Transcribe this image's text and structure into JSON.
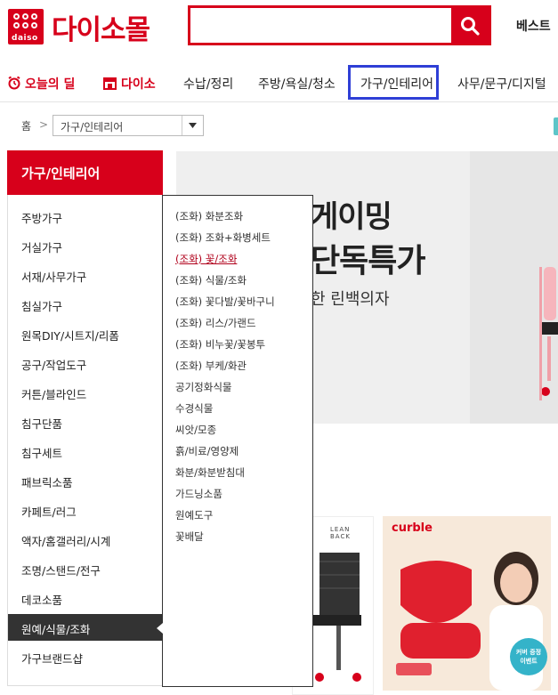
{
  "header": {
    "logo_word": "daiso",
    "logo_text": "다이소몰",
    "search_placeholder": "",
    "best_label": "베스트"
  },
  "nav": {
    "items": [
      {
        "label": "오늘의 딜",
        "icon": "alarm-clock-icon",
        "style": "red"
      },
      {
        "label": "다이소",
        "icon": "shop-icon",
        "style": "red"
      },
      {
        "label": "수납/정리"
      },
      {
        "label": "주방/욕실/청소"
      },
      {
        "label": "가구/인테리어",
        "active": true
      },
      {
        "label": "사무/문구/디지털"
      }
    ]
  },
  "breadcrumb": {
    "home": "홈",
    "select_value": "가구/인테리어"
  },
  "sidebar": {
    "title": "가구/인테리어",
    "items": [
      "주방가구",
      "거실가구",
      "서재/사무가구",
      "침실가구",
      "원목DIY/시트지/리폼",
      "공구/작업도구",
      "커튼/블라인드",
      "침구단품",
      "침구세트",
      "패브릭소품",
      "카페트/러그",
      "액자/홈갤러리/시계",
      "조명/스탠드/전구",
      "데코소품",
      "원예/식물/조화",
      "가구브랜드샵"
    ],
    "active_index": 14
  },
  "flyout": {
    "items": [
      "(조화) 화분조화",
      "(조화) 조화+화병세트",
      "(조화) 꽃/조화",
      "(조화) 식물/조화",
      "(조화) 꽃다발/꽃바구니",
      "(조화) 리스/가랜드",
      "(조화) 비누꽃/꽃봉투",
      "(조화) 부케/화관",
      "공기정화식물",
      "수경식물",
      "씨앗/모종",
      "흙/비료/영양제",
      "화분/화분받침대",
      "가드닝소품",
      "원예도구",
      "꽃배달"
    ],
    "selected_index": 2
  },
  "banner": {
    "line1": "게이밍",
    "line2": "단독특가",
    "sub": "한 린백의자"
  },
  "products": {
    "brand1": "LEAN BACK",
    "brand2": "curble",
    "badge_line1": "커버 증정",
    "badge_line2": "이벤트"
  },
  "colors": {
    "brand_red": "#d7001b",
    "nav_highlight": "#2f3fd6",
    "active_sidebar": "#333333"
  }
}
